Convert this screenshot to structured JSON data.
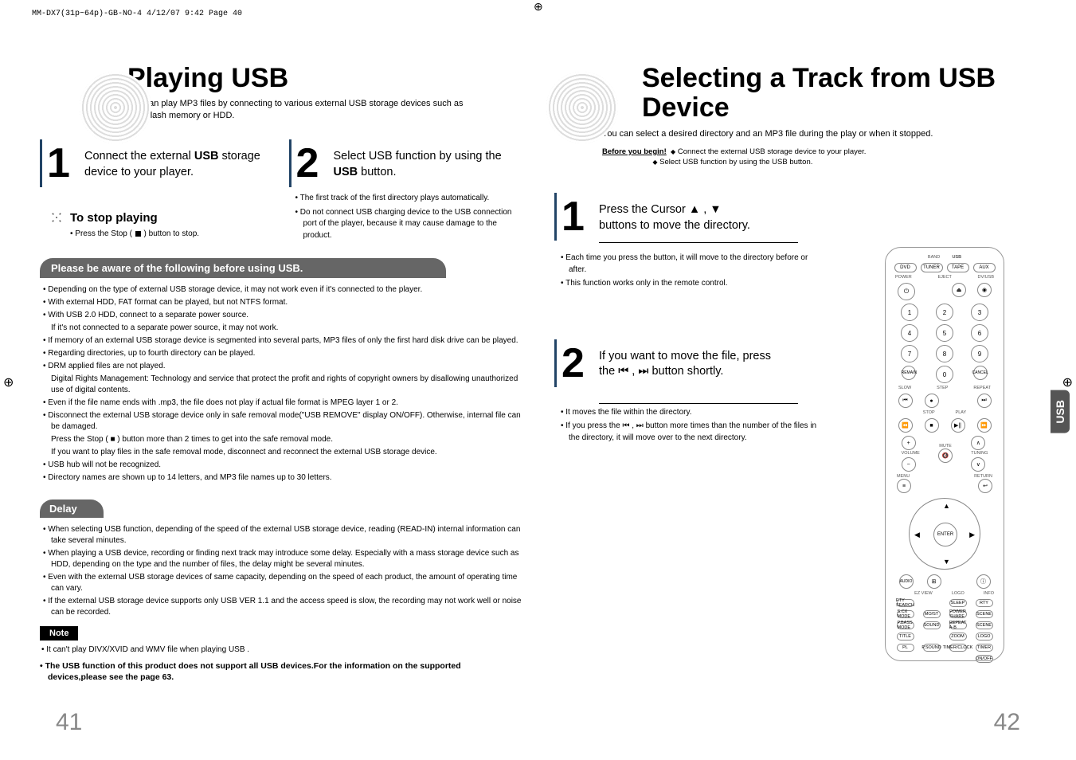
{
  "header_line": "MM-DX7(31p~64p)-GB-NO-4  4/12/07  9:42  Page 40",
  "left": {
    "title": "Playing USB",
    "subtitle": "You can play MP3 files by connecting to various external USB storage devices such as USB flash memory or HDD.",
    "step1_num": "1",
    "step1_text_a": "Connect the external ",
    "step1_text_b": "USB",
    "step1_text_c": " storage device to your player.",
    "step2_num": "2",
    "step2_text_a": "Select USB function by using the ",
    "step2_text_b": "USB",
    "step2_text_c": " button.",
    "step2_sub1": "The first track of the first directory plays automatically.",
    "step2_sub2": "Do not connect USB charging device to the USB connection port of the player, because it may cause damage to the product.",
    "stop_title": "To stop playing",
    "stop_sub_a": "Press the Stop ( ",
    "stop_sub_b": " ) button to stop.",
    "aware_bar": "Please be aware of the following before using USB.",
    "aware": [
      "Depending on the type of external USB storage device, it may not work even if it's connected to the player.",
      "With external HDD, FAT format can be played, but not NTFS format.",
      "With USB 2.0 HDD, connect to a separate power source.",
      "_If it's not connected to a separate power source, it may not work.",
      "If memory of an external USB storage device is segmented into several parts, MP3 files of only the first hard disk drive can be played.",
      "Regarding directories, up to fourth directory can be played.",
      "DRM applied files are not played.",
      "_Digital Rights Management: Technology and service that protect the profit and rights of copyright owners by disallowing unauthorized use of digital contents.",
      "Even if the file name ends with .mp3, the file does not play if actual file format is MPEG layer 1 or 2.",
      "Disconnect the external USB storage device only in safe removal mode(\"USB REMOVE\" display ON/OFF). Otherwise, internal file can be damaged.",
      "_Press the Stop (  ■  ) button more than 2 times to get into the safe removal mode.",
      "_If you want to play files in the safe removal mode, disconnect and reconnect the external USB storage device.",
      "USB hub will not be recognized.",
      "Directory names are shown up to 14 letters, and MP3 file names up to 30 letters."
    ],
    "delay_bar": "Delay",
    "delay": [
      "When selecting USB function, depending of the speed of the external USB storage device, reading (READ-IN) internal information can take several minutes.",
      "When playing a USB device, recording or finding next track may introduce some delay. Especially with a mass storage device such as HDD, depending on the type and the number of files, the delay might be several minutes.",
      "Even with the external USB storage devices of same capacity, depending on the speed of each product, the amount of operating time can vary.",
      "If the external USB storage device supports only USB VER 1.1 and the access speed is slow, the recording may not work well or noise can be recorded."
    ],
    "note_label": "Note",
    "note_text": "It can't play DIVX/XVID and WMV file when playing USB .",
    "bold_line": "The USB function  of this product does not support all USB devices.For the information  on the supported devices,please see the page 63.",
    "pagenum": "41"
  },
  "right": {
    "title": "Selecting a Track from USB Device",
    "subtitle": "You can select a desired directory and an MP3 file during the play or when it stopped.",
    "before_label": "Before you begin!",
    "before1": "Connect the external USB storage device to your player.",
    "before2": "Select USB function by using the USB  button.",
    "step1_num": "1",
    "step1_text_a": "Press the Cursor ",
    "step1_text_b": " ▲ , ▼",
    "step1_text_c": " buttons to move the directory.",
    "step1_sub1": "Each time you press the button, it will move to the directory before or after.",
    "step1_sub2": "This function works only in the remote control.",
    "step2_num": "2",
    "step2_text_a": "If you want to move the file, press the ",
    "step2_text_b": " button shortly.",
    "step2_sub1": "It moves the file within the directory.",
    "step2_sub2_a": "If you press the ",
    "step2_sub2_b": " button more times than the number of the files in the directory, it will move over to the next directory.",
    "pagenum": "42",
    "tab": "USB",
    "remote": {
      "band": "BAND",
      "usb": "USB",
      "top_row": [
        "DVD",
        "TUNER",
        "TAPE",
        "AUX"
      ],
      "power": "POWER",
      "eject": "EJECT",
      "dsleep": "DV/USB",
      "nums": [
        "1",
        "2",
        "3",
        "4",
        "5",
        "6",
        "7",
        "8",
        "9",
        "0"
      ],
      "remain": "REMAIN",
      "cancel": "CANCEL",
      "slow": "SLOW",
      "repeat_lbl": "REPEAT",
      "step": "STEP",
      "stop": "STOP",
      "play": "PLAY",
      "plus": "+",
      "minus": "−",
      "mute": "MUTE",
      "volume": "VOLUME",
      "tuning": "TUNING",
      "menu": "MENU",
      "return": "RETURN",
      "enter": "ENTER",
      "audio": "AUDIO",
      "ez": "EZ VIEW",
      "logo": "LOGO",
      "info": "INFO",
      "bottom_rows": [
        [
          "PTY SEARCH",
          "",
          "SLEEP",
          "RTY"
        ],
        [
          "S.CX MODE",
          "MO/ST",
          "POWER SHARE",
          "SCENE"
        ],
        [
          "P.BASS MODE",
          "SOUND",
          "REPEAT A-B",
          "SCENE"
        ],
        [
          "TITLE",
          "",
          "ZOOM",
          "LOGO"
        ],
        [
          "PL",
          "P.SOUND",
          "TIMER/CLOCK",
          "TIMER"
        ],
        [
          "",
          "",
          "",
          "ON/OFF"
        ]
      ]
    }
  }
}
